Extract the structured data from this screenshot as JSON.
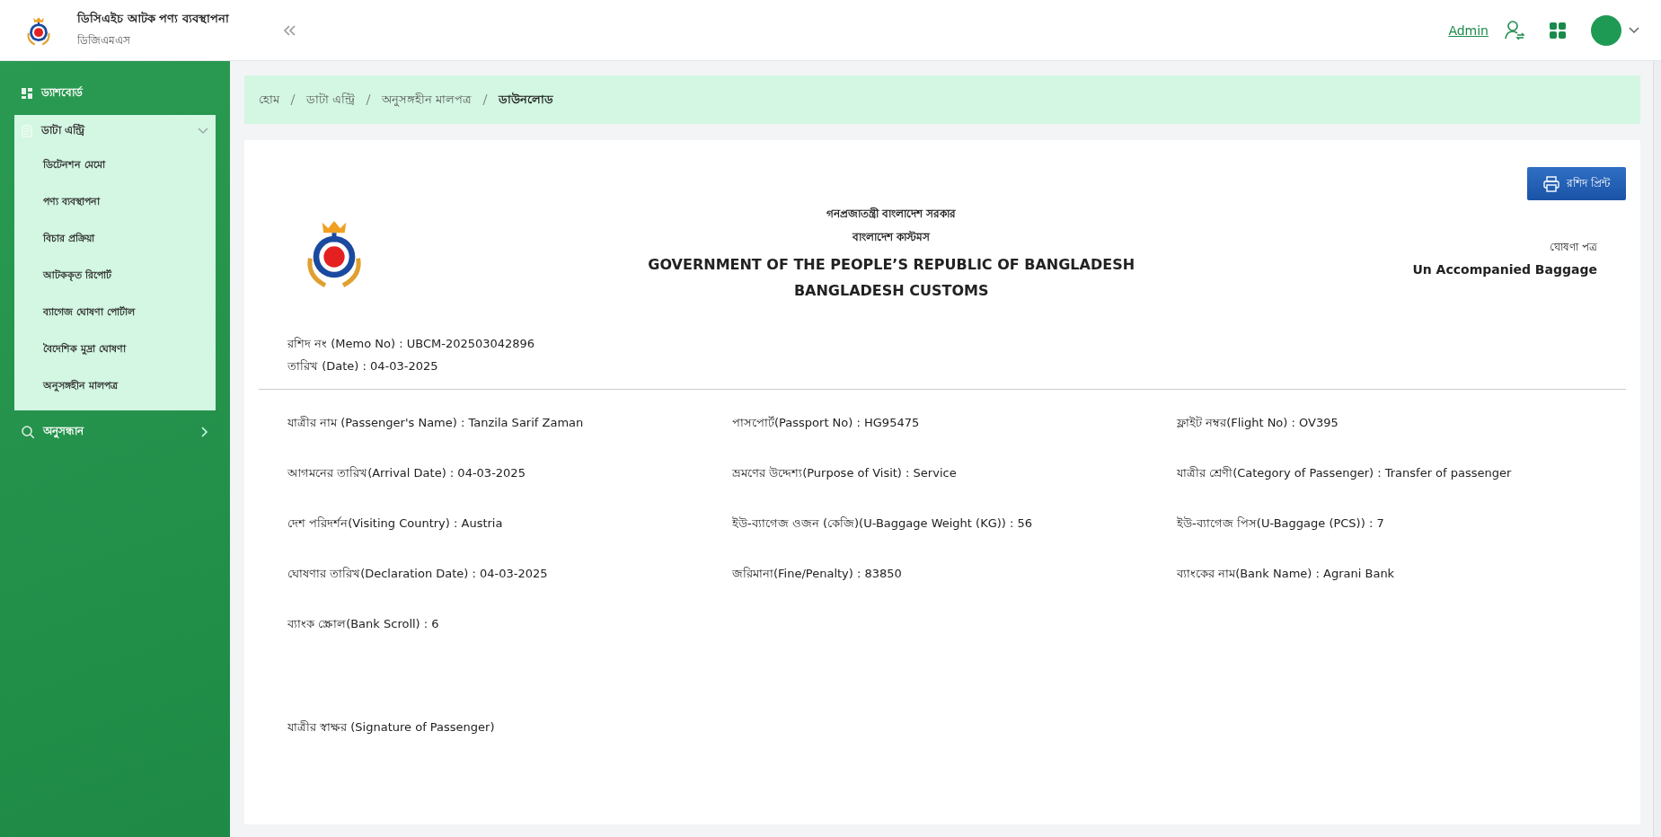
{
  "header": {
    "title": "ডিসিএইচ আটক পণ্য ব্যবস্থাপনা",
    "subtitle": "ডিজিএমএস",
    "user": "Admin"
  },
  "sidebar": {
    "items": [
      {
        "label": "ড্যাশবোর্ড",
        "kind": "link"
      },
      {
        "label": "ডাটা এন্ট্রি",
        "kind": "group",
        "expanded": true,
        "children": [
          {
            "label": "ডিটেনশন মেমো"
          },
          {
            "label": "পণ্য ব্যবস্থাপনা"
          },
          {
            "label": "বিচার প্রক্রিয়া"
          },
          {
            "label": "আটককৃত রিপোর্ট"
          },
          {
            "label": "ব্যাগেজ ঘোষণা পোর্টাল"
          },
          {
            "label": "বৈদেশিক মুদ্রা ঘোষণা"
          },
          {
            "label": "অনুসঙ্গহীন মালপত্র"
          }
        ]
      },
      {
        "label": "অনুসন্ধান",
        "kind": "group",
        "expanded": false
      }
    ]
  },
  "breadcrumb": [
    "হোম",
    "ডাটা এন্ট্রি",
    "অনুসঙ্গহীন মালপত্র",
    "ডাউনলোড"
  ],
  "document": {
    "print_button": "রশিদ প্রিন্ট",
    "heading": [
      "গনপ্রজাতন্ত্রী বাংলাদেশ সরকার",
      "বাংলাদেশ কাস্টমস",
      "GOVERNMENT OF THE PEOPLE’S REPUBLIC OF BANGLADESH",
      "BANGLADESH CUSTOMS"
    ],
    "form_label": "ঘোষণা পত্র",
    "form_type": "Un Accompanied Baggage",
    "memo": [
      "রশিদ নং (Memo No) : UBCM-202503042896",
      "তারিখ (Date) : 04-03-2025"
    ],
    "fields": [
      "যাত্রীর নাম (Passenger's Name) : Tanzila Sarif Zaman",
      "পাসপোর্ট(Passport No) : HG95475",
      "ফ্লাইট নম্বর(Flight No) : OV395",
      "আগমনের তারিখ(Arrival Date) : 04-03-2025",
      "ভ্রমণের উদ্দেশ্য(Purpose of Visit) : Service",
      "যাত্রীর শ্রেণী(Category of Passenger) : Transfer of passenger",
      "দেশ পরিদর্শন(Visiting Country) : Austria",
      "ইউ-ব্যাগেজ ওজন (কেজি)(U-Baggage Weight (KG)) : 56",
      "ইউ-ব্যাগেজ পিস(U-Baggage (PCS)) : 7",
      "ঘোষণার তারিখ(Declaration Date) : 04-03-2025",
      "জরিমানা(Fine/Penalty) : 83850",
      "ব্যাংকের নাম(Bank Name) : Agrani Bank",
      "ব্যাংক স্ক্রোল(Bank Scroll) : 6"
    ],
    "signature": "যাত্রীর স্বাক্ষর (Signature of Passenger)"
  }
}
